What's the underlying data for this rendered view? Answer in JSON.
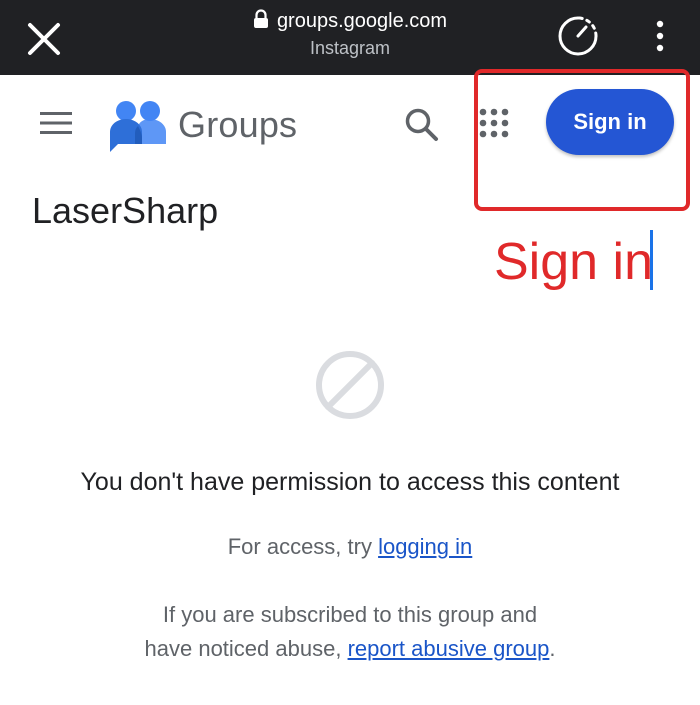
{
  "browser": {
    "url": "groups.google.com",
    "source_app": "Instagram",
    "icons": [
      "close-icon",
      "lock-icon",
      "timer-icon",
      "more-vert-icon"
    ]
  },
  "header": {
    "brand": "Groups",
    "signin_label": "Sign in",
    "icons": [
      "menu-icon",
      "groups-logo-icon",
      "search-icon",
      "apps-grid-icon"
    ]
  },
  "group": {
    "name": "LaserSharp"
  },
  "annotation": {
    "text": "Sign in",
    "color": "#e0292a"
  },
  "content": {
    "permission_message": "You don't have permission to access this content",
    "access_prefix": "For access, try ",
    "access_link": "logging in",
    "abuse_line1": "If you are subscribed to this group and",
    "abuse_prefix": "have noticed abuse, ",
    "abuse_link": "report abusive group",
    "abuse_suffix": "."
  },
  "colors": {
    "topbar": "#202124",
    "primary_button": "#2456d4",
    "link": "#1a55c8"
  }
}
